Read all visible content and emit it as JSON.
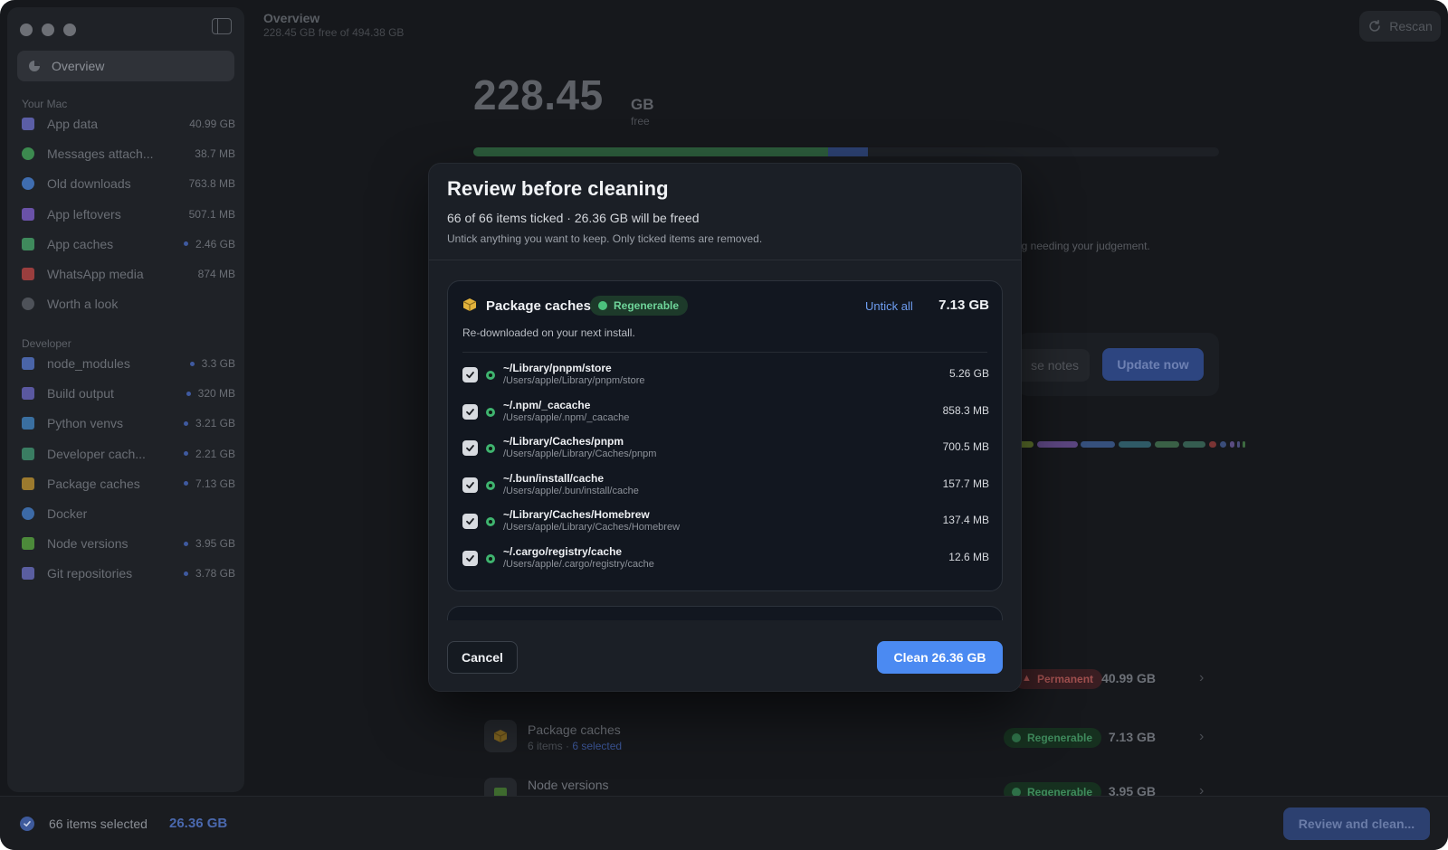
{
  "window": {
    "title": "Overview",
    "subtitle": "228.45 GB free of 494.38 GB",
    "rescan_label": "Rescan"
  },
  "sidebar": {
    "active_item": "Overview",
    "sections": [
      {
        "title": "Your Mac",
        "items": [
          {
            "label": "App data",
            "size": "40.99 GB",
            "dot": false,
            "color": "#5b5ea6",
            "icon": "grid-icon"
          },
          {
            "label": "Messages attach...",
            "size": "38.7 MB",
            "dot": false,
            "color": "#3c8a4f",
            "icon": "message-icon"
          },
          {
            "label": "Old downloads",
            "size": "763.8 MB",
            "dot": false,
            "color": "#3f6db0",
            "icon": "download-icon"
          },
          {
            "label": "App leftovers",
            "size": "507.1 MB",
            "dot": false,
            "color": "#6a52a8",
            "icon": "cube-icon"
          },
          {
            "label": "App caches",
            "size": "2.46 GB",
            "dot": true,
            "color": "#3f8a5c",
            "icon": "layers-icon"
          },
          {
            "label": "WhatsApp media",
            "size": "874 MB",
            "dot": false,
            "color": "#9a3e3e",
            "icon": "media-icon"
          },
          {
            "label": "Worth a look",
            "size": "",
            "dot": false,
            "color": "#4e5259",
            "icon": "info-icon"
          }
        ]
      },
      {
        "title": "Developer",
        "items": [
          {
            "label": "node_modules",
            "size": "3.3 GB",
            "dot": true,
            "color": "#4a65a8",
            "icon": "cube-icon"
          },
          {
            "label": "Build output",
            "size": "320 MB",
            "dot": true,
            "color": "#5a58a0",
            "icon": "hammer-icon"
          },
          {
            "label": "Python venvs",
            "size": "3.21 GB",
            "dot": true,
            "color": "#3a6fa0",
            "icon": "code-icon"
          },
          {
            "label": "Developer cach...",
            "size": "2.21 GB",
            "dot": true,
            "color": "#3a7d62",
            "icon": "drive-icon"
          },
          {
            "label": "Package caches",
            "size": "7.13 GB",
            "dot": true,
            "color": "#9c7a2e",
            "icon": "package-icon"
          },
          {
            "label": "Docker",
            "size": "",
            "dot": false,
            "color": "#3c6aa6",
            "icon": "docker-icon"
          },
          {
            "label": "Node versions",
            "size": "3.95 GB",
            "dot": true,
            "color": "#4c8a3a",
            "icon": "node-icon"
          },
          {
            "label": "Git repositories",
            "size": "3.78 GB",
            "dot": true,
            "color": "#5a5ea0",
            "icon": "git-branch-icon"
          }
        ]
      }
    ]
  },
  "overview": {
    "free_value": "228.45",
    "free_unit": "GB",
    "free_label": "free",
    "judgement_text": "ng needing your judgement.",
    "release_notes_label": "se notes",
    "update_label": "Update now",
    "rows": [
      {
        "name": "Package caches",
        "meta": "6 items · ",
        "selected": "6 selected",
        "badge": "Regenerable",
        "size": "7.13 GB"
      },
      {
        "name": "Node versions",
        "badge": "Regenerable",
        "size": "3.95 GB"
      }
    ],
    "permanent_row": {
      "badge": "Permanent",
      "size": "40.99 GB"
    }
  },
  "bottom_bar": {
    "selected_count": "66 items selected",
    "selected_size": "26.36 GB",
    "review_label": "Review and clean..."
  },
  "modal": {
    "title": "Review before cleaning",
    "summary": "66 of 66 items ticked · 26.36 GB will be freed",
    "hint": "Untick anything you want to keep. Only ticked items are removed.",
    "group": {
      "name": "Package caches",
      "badge": "Regenerable",
      "untick_label": "Untick all",
      "size": "7.13 GB",
      "description": "Re-downloaded on your next install.",
      "items": [
        {
          "path": "~/Library/pnpm/store",
          "full": "/Users/apple/Library/pnpm/store",
          "size": "5.26 GB",
          "checked": true
        },
        {
          "path": "~/.npm/_cacache",
          "full": "/Users/apple/.npm/_cacache",
          "size": "858.3 MB",
          "checked": true
        },
        {
          "path": "~/Library/Caches/pnpm",
          "full": "/Users/apple/Library/Caches/pnpm",
          "size": "700.5 MB",
          "checked": true
        },
        {
          "path": "~/.bun/install/cache",
          "full": "/Users/apple/.bun/install/cache",
          "size": "157.7 MB",
          "checked": true
        },
        {
          "path": "~/Library/Caches/Homebrew",
          "full": "/Users/apple/Library/Caches/Homebrew",
          "size": "137.4 MB",
          "checked": true
        },
        {
          "path": "~/.cargo/registry/cache",
          "full": "/Users/apple/.cargo/registry/cache",
          "size": "12.6 MB",
          "checked": true
        }
      ]
    },
    "cancel_label": "Cancel",
    "clean_label": "Clean 26.36 GB"
  }
}
